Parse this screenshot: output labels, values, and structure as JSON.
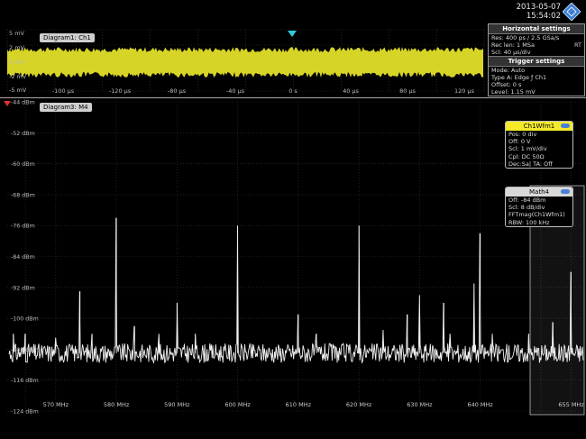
{
  "header": {
    "date": "2013-05-07",
    "time": "15:54:02"
  },
  "colors": {
    "time_trace": "#e3df2a",
    "spectrum_trace": "#f0f0f0",
    "grid": "#555555",
    "ch1_header": "#f4ea2a",
    "math_header": "#d8d8d8",
    "background": "#000000",
    "trigger_marker": "#33c8d8",
    "ref_marker": "#e03030"
  },
  "icons": {
    "logo": "rs-logo-icon",
    "ch1_toggle": "toggle-icon",
    "math_toggle": "toggle-icon",
    "trigger": "trigger-arrow-icon",
    "ref": "reference-marker-icon"
  },
  "diagram1": {
    "label": "Diagram1: Ch1",
    "y_ticks": [
      "5 mV",
      "2 mV",
      "0 mV",
      "-2 mV",
      "-5 mV"
    ],
    "x_ticks": [
      "-100 µs",
      "-120 µs",
      "-80 µs",
      "-40 µs",
      "0 s",
      "40 µs",
      "80 µs",
      "120 µs"
    ]
  },
  "diagram3": {
    "label": "Diagram3: M4",
    "y_ticks": [
      "-44 dBm",
      "-52 dBm",
      "-60 dBm",
      "-68 dBm",
      "-76 dBm",
      "-84 dBm",
      "-92 dBm",
      "-100 dBm",
      "-108 dBm",
      "-116 dBm",
      "-124 dBm"
    ],
    "x_ticks": [
      "570 MHz",
      "580 MHz",
      "590 MHz",
      "600 MHz",
      "610 MHz",
      "620 MHz",
      "630 MHz",
      "640 MHz",
      "655 MHz"
    ]
  },
  "horizontal_settings": {
    "title": "Horizontal settings",
    "rows": [
      "Res:     400 ps / 2.5 GSa/s",
      "Rec len: 1 MSa",
      "Scl:      40 µs/div"
    ],
    "rt": "RT"
  },
  "trigger_settings": {
    "title": "Trigger settings",
    "rows": [
      "Mode:    Auto",
      "Type A:  Edge  ƒ Ch1",
      "Offset:  0 s",
      "Level:   1.15 mV"
    ]
  },
  "ch1_box": {
    "title": "Ch1Wfm1",
    "rows": [
      "Pos: 0 div",
      "Off:  0 V",
      "Scl:  1 mV/div",
      "Cpl: DC 50Ω",
      "Dec:Sa|  TA: Off"
    ]
  },
  "math_box": {
    "title": "Math4",
    "rows": [
      "Off:   -84 dBm",
      "Scl:   8 dB/div",
      "FFTmag(Ch1Wfm1)",
      "RBW: 100 kHz"
    ]
  },
  "chart_data": {
    "type": "line",
    "title": "Diagram3: M4",
    "xlabel": "",
    "ylabel": "",
    "x_unit": "MHz",
    "y_unit": "dBm",
    "xlim": [
      562,
      657
    ],
    "ylim": [
      -124,
      -44
    ],
    "noise_floor_dBm": -109,
    "grid": true,
    "series": [
      {
        "x": [
          563,
          565,
          570,
          574,
          576,
          580,
          583,
          587,
          590,
          593,
          600,
          610,
          613,
          620,
          624,
          628,
          630,
          634,
          635,
          639,
          640,
          642,
          648,
          652,
          655
        ],
        "y": [
          -104,
          -104,
          -105,
          -93,
          -104,
          -74,
          -102,
          -104,
          -96,
          -104,
          -76,
          -99,
          -104,
          -76,
          -103,
          -99,
          -94,
          -96,
          -104,
          -91,
          -78,
          -104,
          -104,
          -101,
          -88
        ]
      }
    ]
  }
}
